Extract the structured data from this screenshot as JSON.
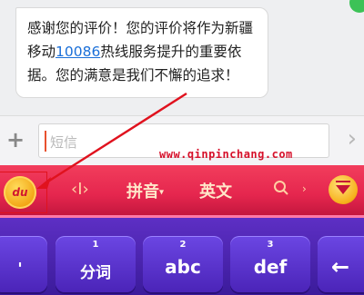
{
  "message": {
    "prefix": "感谢您的评价！您的评价将作为新疆移动",
    "link": "10086",
    "suffix": "热线服务提升的重要依据。您的满意是我们不懈的追求！"
  },
  "input": {
    "placeholder": "短信",
    "watermark": "www.qinpinchang.com"
  },
  "keyboard": {
    "logo_text": "du",
    "toolbar": {
      "cursor_icon": "‹I›",
      "pinyin": "拼音",
      "english": "英文"
    },
    "keys": [
      {
        "num": "",
        "label": "'"
      },
      {
        "num": "1",
        "label": "分词"
      },
      {
        "num": "2",
        "label": "abc"
      },
      {
        "num": "3",
        "label": "def"
      },
      {
        "num": "",
        "label": "←"
      }
    ]
  },
  "colors": {
    "accent_red": "#e5264e",
    "key_purple": "#4b24b8",
    "link_blue": "#1a6fd8",
    "annotation_red": "#e0121e"
  }
}
